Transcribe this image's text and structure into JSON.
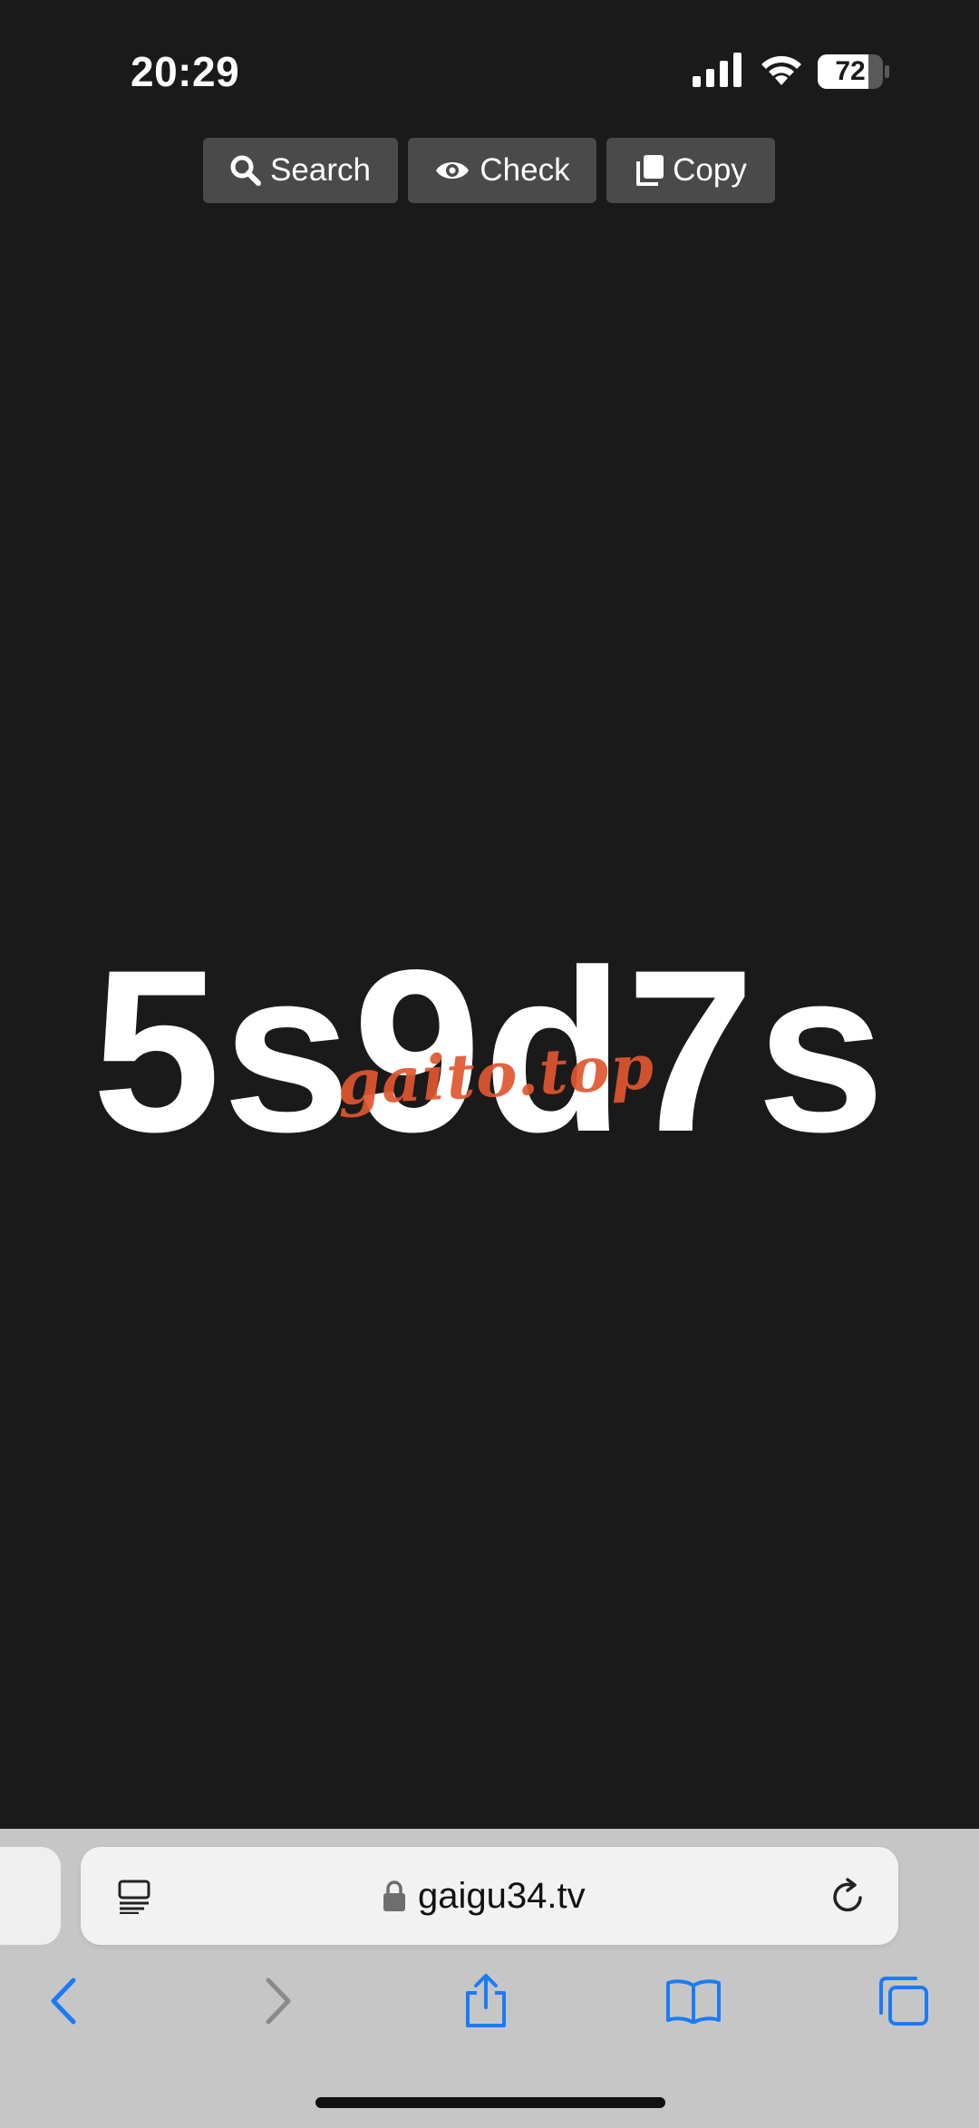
{
  "status_bar": {
    "time": "20:29",
    "battery": "72"
  },
  "toolbar": {
    "search_label": "Search",
    "check_label": "Check",
    "copy_label": "Copy"
  },
  "main": {
    "code": "5s9d7s",
    "watermark": "gaito.top"
  },
  "browser": {
    "url": "gaigu34.tv"
  },
  "colors": {
    "background": "#1a1a1b",
    "button": "#4a4a4a",
    "watermark": "#e0562f",
    "chrome": "#c6c6c7",
    "accent_blue": "#1a7cf5"
  },
  "icons": [
    "signal-icon",
    "wifi-icon",
    "battery-icon",
    "search-icon",
    "eye-icon",
    "copy-icon",
    "reader-icon",
    "lock-icon",
    "reload-icon",
    "back-icon",
    "forward-icon",
    "share-icon",
    "bookmarks-icon",
    "tabs-icon"
  ]
}
